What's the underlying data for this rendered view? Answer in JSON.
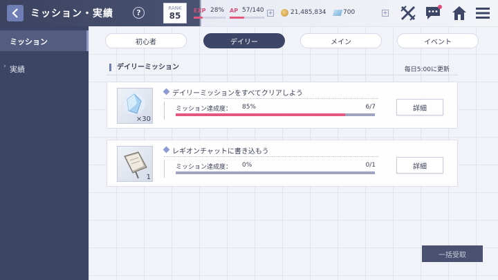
{
  "header": {
    "title": "ミッション・実績",
    "help_label": "?",
    "rank_label": "RANK",
    "rank_value": "85",
    "exp_label": "EXP",
    "exp_value": "28%",
    "exp_fraction": 0.28,
    "ap_label": "AP",
    "ap_value": "57/140",
    "ap_fraction": 0.41,
    "plus_label": "+",
    "coins": "21,485,834",
    "gems": "700"
  },
  "sidebar": {
    "items": [
      {
        "label": "ミッション",
        "active": true
      },
      {
        "label": "実績",
        "active": false,
        "arrow": "›"
      }
    ]
  },
  "tabs": [
    {
      "label": "初心者",
      "active": false
    },
    {
      "label": "デイリー",
      "active": true
    },
    {
      "label": "メイン",
      "active": false
    },
    {
      "label": "イベント",
      "active": false
    }
  ],
  "section": {
    "title": "デイリーミッション",
    "update_text": "毎日5:00に更新"
  },
  "missions": [
    {
      "title": "デイリーミッションをすべてクリアしよう",
      "progress_label": "ミッション達成度：",
      "progress_pct": "85%",
      "progress_fraction": 0.85,
      "count": "6/7",
      "reward_qty": "×30",
      "reward_icon": "crystal-icon",
      "detail_label": "詳細"
    },
    {
      "title": "レギオンチャットに書き込もう",
      "progress_label": "ミッション達成度：",
      "progress_pct": "0%",
      "progress_fraction": 0,
      "count": "0/1",
      "reward_qty": "1",
      "reward_icon": "book-icon",
      "detail_label": "詳細"
    }
  ],
  "claim_all_label": "一括受取",
  "colors": {
    "accent": "#e4587e",
    "dark": "#3e4667",
    "sidebar": "#3c4563"
  }
}
